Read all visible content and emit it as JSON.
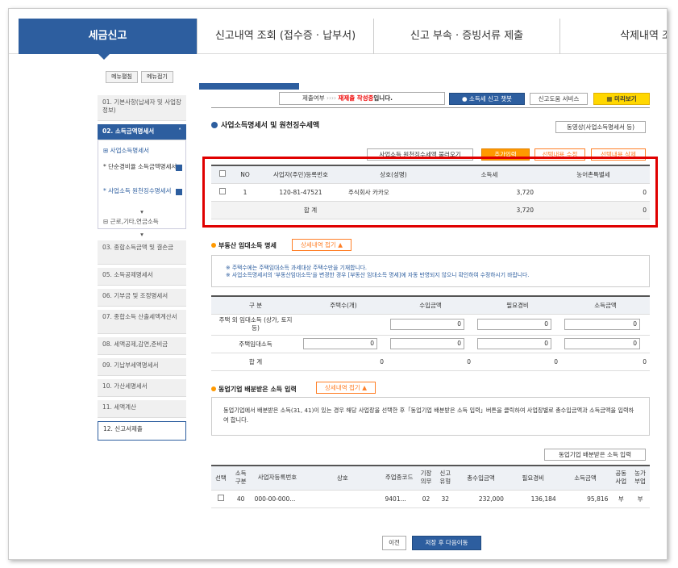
{
  "topnav": {
    "tabs": [
      "세금신고",
      "신고내역 조회 (접수증 · 납부서)",
      "신고 부속 · 증빙서류 제출",
      "삭제내역 조"
    ]
  },
  "sidebar": {
    "expand": "메뉴펼침",
    "collapse": "메뉴접기",
    "items": [
      "01. 기본사항(납세자 및 사업장정보)",
      "02. 소득금액명세서",
      "03. 종합소득금액 및 결손금",
      "05. 소득공제명세서",
      "06. 기부금 및 조정명세서",
      "07. 종합소득 산출세액계산서",
      "08. 세액공제,감면,준비금",
      "09. 기납부세액명세서",
      "10. 가산세명세서",
      "11. 세액계산",
      "12. 신고서제출"
    ],
    "subs": [
      "사업소득명세서",
      "단순경비율 소득금액명세서",
      "사업소득 원천징수명세서",
      "근로,기타,연금소득"
    ]
  },
  "status": {
    "label": "제출여부",
    "arrows": "››››",
    "value": "재제출 작성중",
    "suffix": "입니다.",
    "chatbot": "소득세 신고 챗봇",
    "help": "신고도움 서비스",
    "preview": "미리보기"
  },
  "section1": {
    "title": "사업소득명세서 및 원천징수세액",
    "video": "동영상(사업소득명세서 등)",
    "btn_load": "사업소득 원천징수세액 불러오기",
    "btn_add": "추가입력",
    "btn_edit": "선택내용 수정",
    "btn_delete": "선택내용 삭제",
    "headers": [
      "NO",
      "사업자(주민)등록번호",
      "상호(성명)",
      "소득세",
      "농어촌특별세"
    ],
    "row": {
      "no": "1",
      "reg": "120-81-47521",
      "name": "주식회사 카카오",
      "tax": "3,720",
      "rural": "0"
    },
    "total": {
      "label": "합 계",
      "tax": "3,720",
      "rural": "0"
    }
  },
  "section2": {
    "title": "부동산 임대소득 명세",
    "toggle": "상세내역 접기 ▲",
    "note1": "※ 주택수에는 주택임대소득 과세대상 주택수만을 기재합니다.",
    "note2": "※ 사업소득명세서의 '부동산임대소득'을 변경한 경우 [부동산 임대소득 명세]에 자동 반영되지 않으니 확인하여 수정하시기 바랍니다.",
    "headers": [
      "구 분",
      "주택수(개)",
      "수입금액",
      "필요경비",
      "소득금액"
    ],
    "rows": [
      {
        "label": "주택 외 임대소득 (상가, 토지 등)",
        "values": [
          "0",
          "0",
          "0"
        ]
      },
      {
        "label": "주택임대소득",
        "count": "0",
        "values": [
          "0",
          "0",
          "0"
        ]
      },
      {
        "label": "합 계",
        "count": "0",
        "values": [
          "0",
          "0",
          "0"
        ]
      }
    ]
  },
  "section3": {
    "title": "동업기업 배분받은 소득 입력",
    "toggle": "상세내역 접기 ▲",
    "note": "동업기업에서 배분받은 소득(31, 41)이 있는 경우 해당 사업장을 선택한 후「동업기업 배분받은 소득 입력」버튼을 클릭하여 사업장별로 총수입금액과 소득금액을 입력하여 합니다.",
    "btn": "동업기업 배분받은 소득 입력",
    "headers": [
      "선택",
      "소득구분",
      "사업자등록번호",
      "상호",
      "주업종코드",
      "기장의무",
      "신고유형",
      "총수입금액",
      "필요경비",
      "소득금액",
      "공동사업",
      "농가부업"
    ],
    "row": [
      "40",
      "000-00-000...",
      "",
      "9401...",
      "02",
      "32",
      "232,000",
      "136,184",
      "95,816",
      "부",
      "부"
    ]
  },
  "footer": {
    "prev": "이전",
    "save": "저장 후 다음이동"
  }
}
